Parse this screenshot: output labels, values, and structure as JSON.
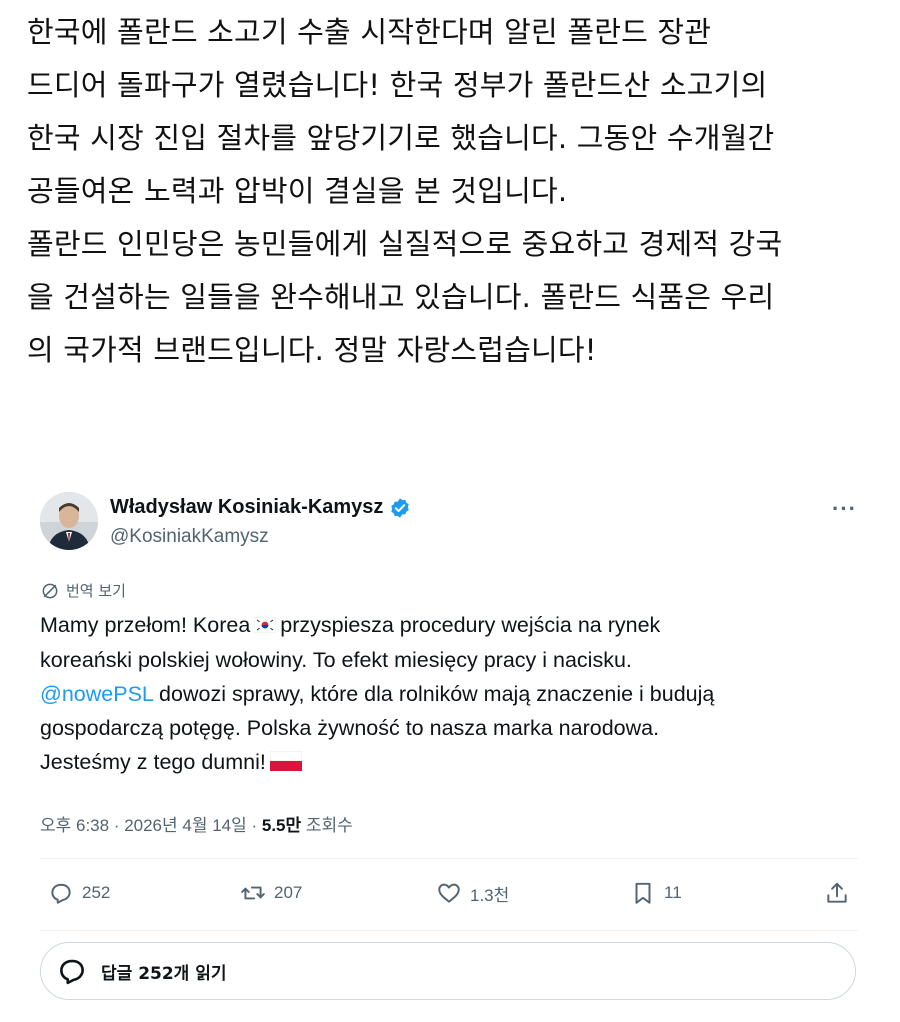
{
  "caption": {
    "lines": [
      "한국에 폴란드 소고기 수출 시작한다며 알린 폴란드 장관",
      "드디어 돌파구가 열렸습니다! 한국 정부가 폴란드산 소고기의",
      "한국 시장 진입 절차를 앞당기기로 했습니다. 그동안 수개월간",
      "공들여온 노력과 압박이 결실을 본 것입니다.",
      "폴란드 인민당은 농민들에게 실질적으로 중요하고 경제적 강국",
      "을 건설하는 일들을 완수해내고 있습니다. 폴란드 식품은 우리",
      "의 국가적 브랜드입니다. 정말 자랑스럽습니다!"
    ]
  },
  "tweet": {
    "author_name": "Władysław Kosiniak-Kamysz",
    "handle": "@KosiniakKamysz",
    "translate_label": "번역 보기",
    "text": {
      "line1_a": "Mamy przełom! Korea",
      "line1_b": "przyspiesza procedury wejścia na rynek",
      "line2": "koreański polskiej wołowiny. To efekt miesięcy pracy i nacisku.",
      "line3_mention": "@nowePSL",
      "line3_rest": " dowozi sprawy, które dla rolników mają znaczenie i budują",
      "line4": "gospodarczą potęgę. Polska żywność to nasza marka narodowa.",
      "line5": "Jesteśmy z tego dumni!"
    },
    "meta": {
      "time_date": "오후 6:38 · 2026년 4월 14일 · ",
      "views": "5.5만",
      "views_label": " 조회수"
    },
    "actions": {
      "replies": "252",
      "reposts": "207",
      "likes": "1.3천",
      "bookmarks": "11"
    },
    "read_replies_label": "답글 252개 읽기"
  },
  "colors": {
    "link": "#1d9bf0",
    "secondary_text": "#536471",
    "verified": "#1d9bf0"
  }
}
